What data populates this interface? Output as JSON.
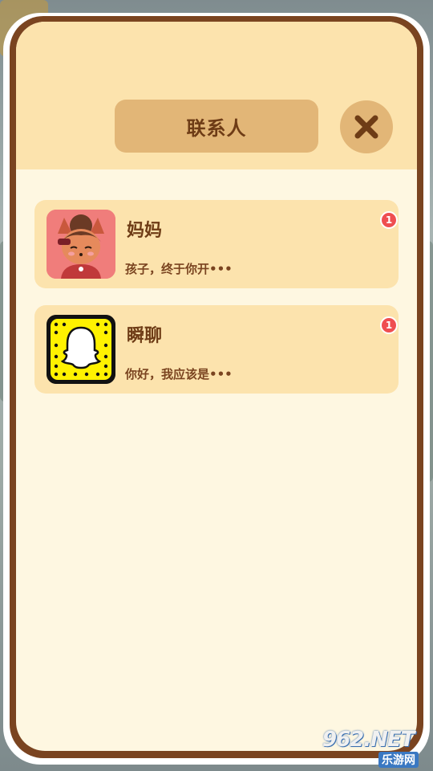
{
  "dialog": {
    "title": "联系人"
  },
  "contacts": [
    {
      "name": "妈妈",
      "preview": "孩子，终于你开•••",
      "unread": "1",
      "avatar_icon": "fox-girl-avatar-icon"
    },
    {
      "name": "瞬聊",
      "preview": "你好，我应该是•••",
      "unread": "1",
      "avatar_icon": "ghost-app-icon"
    }
  ],
  "watermark": {
    "main": "962.NET",
    "sub": "乐游网"
  },
  "colors": {
    "panel_bg": "#fef7e1",
    "header_bg": "#fce3ad",
    "button_bg": "#e2b677",
    "frame": "#7a4420",
    "text": "#6e3c16",
    "badge": "#ef4e50",
    "snap_yellow": "#fff200"
  }
}
